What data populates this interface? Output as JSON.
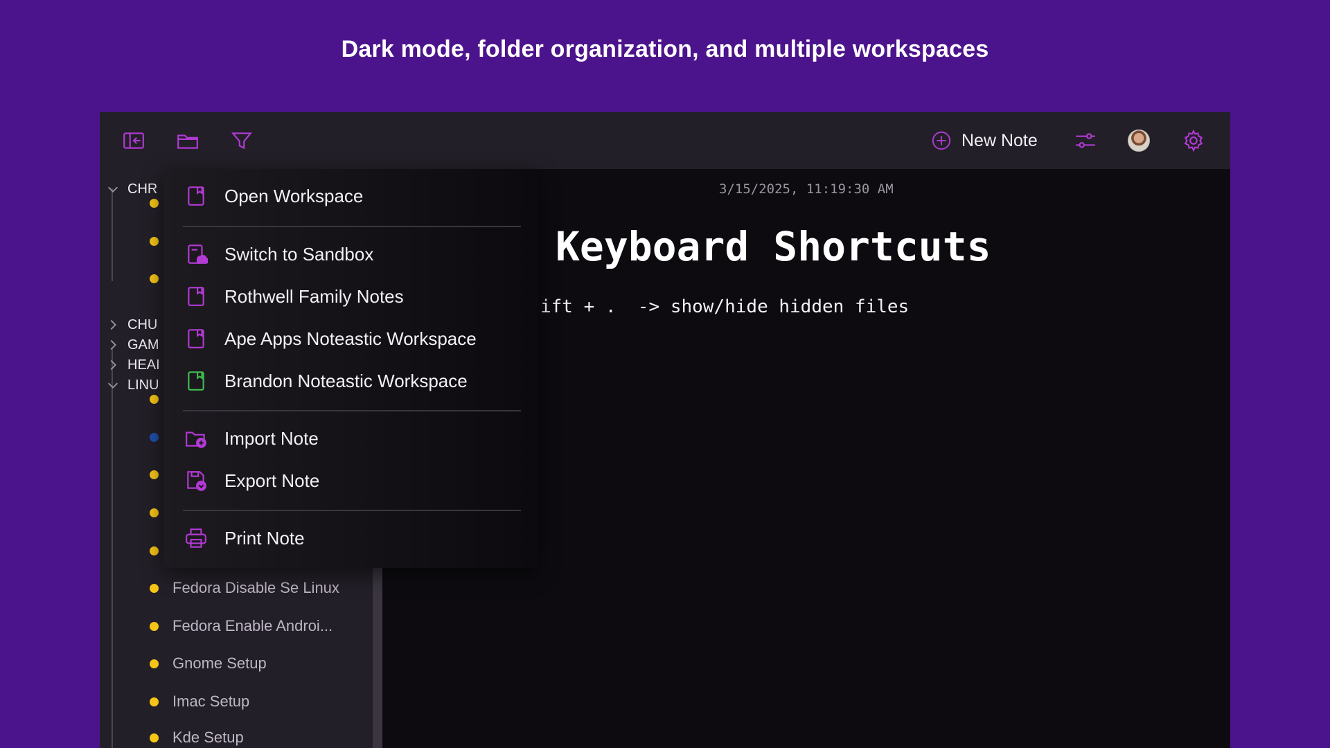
{
  "headline": "Dark mode, folder organization, and multiple workspaces",
  "colors": {
    "background": "#4c148c",
    "accent": "#b33ad6",
    "green": "#3fbf4f",
    "note_dot": "#f5c518",
    "note_dot_blue": "#1e4fa8"
  },
  "toolbar": {
    "icons": [
      "sidebar-collapse-icon",
      "folder-icon",
      "filter-icon",
      "sliders-icon",
      "gear-icon"
    ],
    "new_note_label": "New Note"
  },
  "sidebar": {
    "folders": [
      {
        "label": "CHR",
        "expanded": true
      },
      {
        "label": "CHU",
        "expanded": false
      },
      {
        "label": "GAM",
        "expanded": false
      },
      {
        "label": "HEAI",
        "expanded": false
      },
      {
        "label": "LINU",
        "expanded": true
      }
    ],
    "notes": [
      {
        "label": "Fedora Disable Se Linux"
      },
      {
        "label": "Fedora Enable Androi..."
      },
      {
        "label": "Gnome Setup"
      },
      {
        "label": "Imac Setup"
      },
      {
        "label": "Kde Setup"
      }
    ]
  },
  "editor": {
    "timestamp": "3/15/2025, 11:19:30 AM",
    "title": "Keyboard Shortcuts",
    "line": "ift + .  -> show/hide hidden files"
  },
  "menu": {
    "items": [
      {
        "label": "Open Workspace",
        "icon": "workspace-icon"
      },
      {
        "label": "Switch to Sandbox",
        "icon": "sandbox-icon"
      },
      {
        "label": "Rothwell Family Notes",
        "icon": "workspace-icon"
      },
      {
        "label": "Ape Apps Noteastic Workspace",
        "icon": "workspace-icon"
      },
      {
        "label": "Brandon Noteastic Workspace",
        "icon": "workspace-active-icon"
      },
      {
        "label": "Import Note",
        "icon": "import-icon"
      },
      {
        "label": "Export Note",
        "icon": "export-icon"
      },
      {
        "label": "Print Note",
        "icon": "printer-icon"
      }
    ]
  }
}
